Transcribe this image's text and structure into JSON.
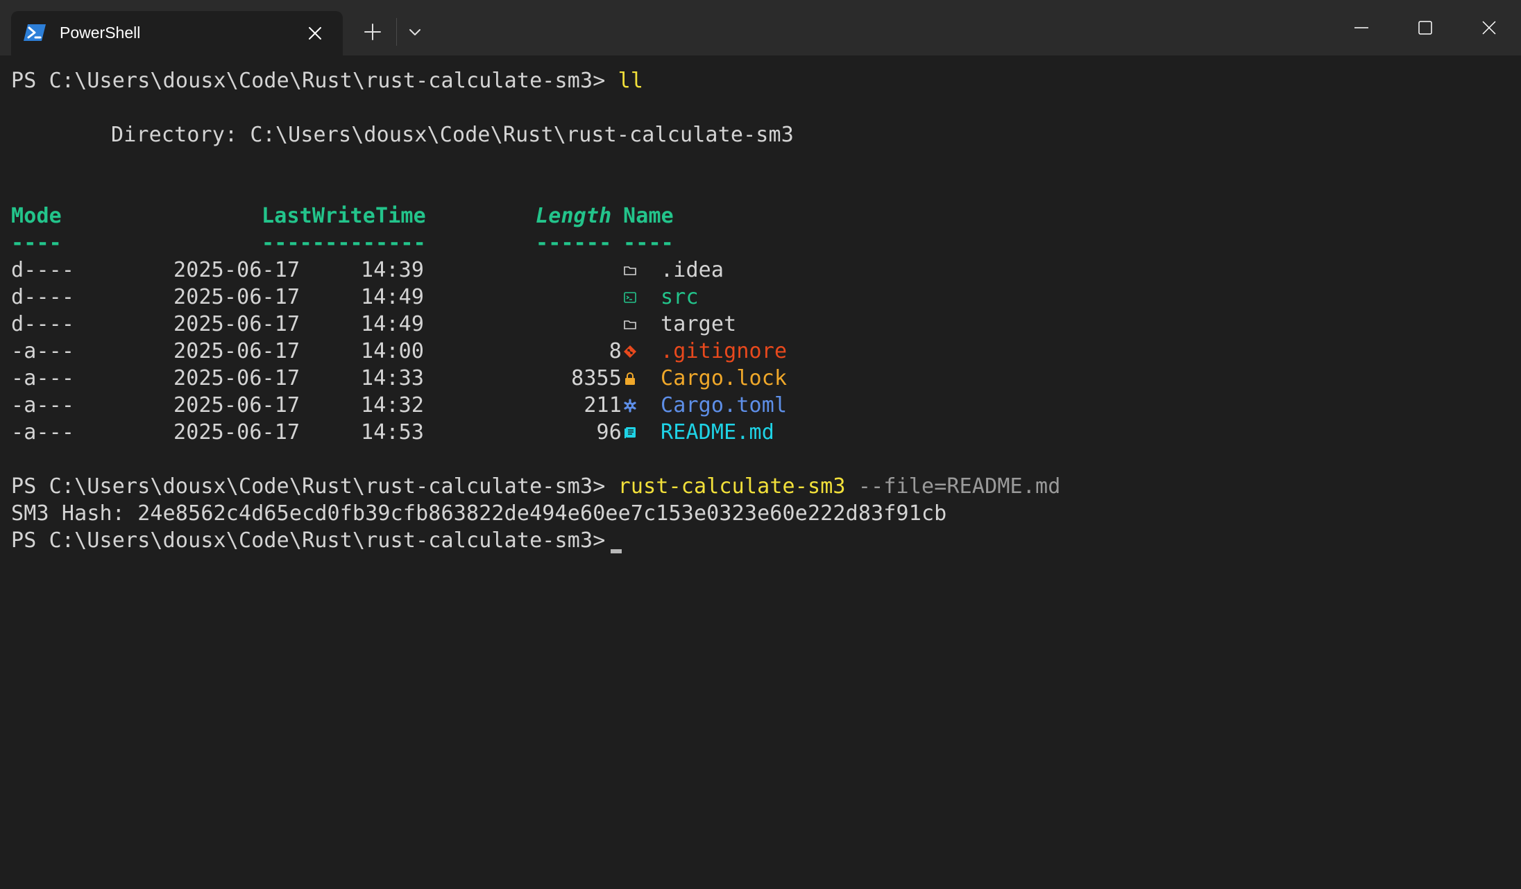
{
  "tab": {
    "title": "PowerShell",
    "icon": "powershell-icon"
  },
  "colors": {
    "background": "#1e1e1e",
    "titlebar": "#2b2b2b",
    "header": "#23c48b",
    "command": "#f2e03a",
    "folder_src": "#23c48b",
    "gitignore": "#e8491d",
    "lock": "#f0a82a",
    "toml": "#5e8fe8",
    "readme": "#1fd3e6"
  },
  "terminal": {
    "prompt": "PS C:\\Users\\dousx\\Code\\Rust\\rust-calculate-sm3>",
    "cmd1": "ll",
    "directory_line": "Directory: C:\\Users\\dousx\\Code\\Rust\\rust-calculate-sm3",
    "headers": {
      "mode": "Mode",
      "lastwrite": "LastWriteTime",
      "length": "Length",
      "name": "Name"
    },
    "underlines": {
      "mode": "----",
      "lastwrite": "-------------",
      "length": "------",
      "name": "----"
    },
    "entries": [
      {
        "mode": "d----",
        "date": "2025-06-17",
        "time": "14:39",
        "length": "",
        "name": ".idea",
        "icon": "folder-icon"
      },
      {
        "mode": "d----",
        "date": "2025-06-17",
        "time": "14:49",
        "length": "",
        "name": "src",
        "icon": "terminal-folder-icon"
      },
      {
        "mode": "d----",
        "date": "2025-06-17",
        "time": "14:49",
        "length": "",
        "name": "target",
        "icon": "folder-icon"
      },
      {
        "mode": "-a---",
        "date": "2025-06-17",
        "time": "14:00",
        "length": "8",
        "name": ".gitignore",
        "icon": "git-icon"
      },
      {
        "mode": "-a---",
        "date": "2025-06-17",
        "time": "14:33",
        "length": "8355",
        "name": "Cargo.lock",
        "icon": "lock-icon"
      },
      {
        "mode": "-a---",
        "date": "2025-06-17",
        "time": "14:32",
        "length": "211",
        "name": "Cargo.toml",
        "icon": "gear-icon"
      },
      {
        "mode": "-a---",
        "date": "2025-06-17",
        "time": "14:53",
        "length": "96",
        "name": "README.md",
        "icon": "markdown-icon"
      }
    ],
    "cmd2": "rust-calculate-sm3",
    "cmd2_args": "--file=README.md",
    "hash_line": "SM3 Hash: 24e8562c4d65ecd0fb39cfb863822de494e60ee7c153e0323e60e222d83f91cb"
  }
}
